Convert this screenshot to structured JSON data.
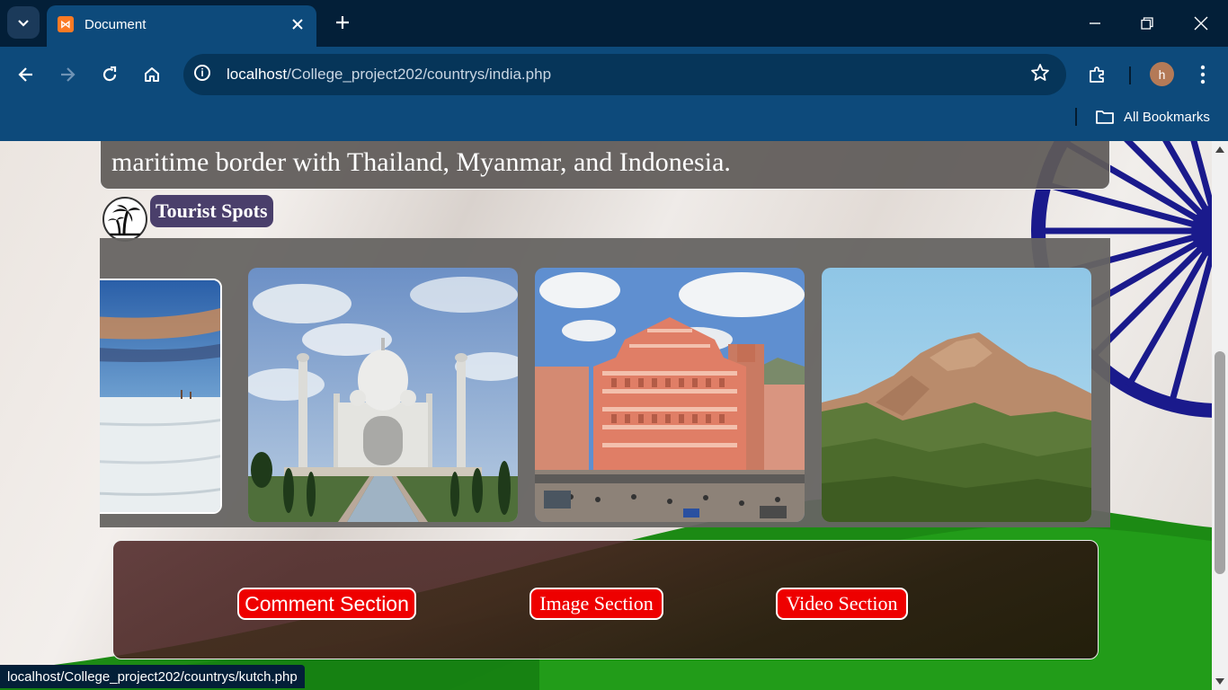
{
  "browser": {
    "tab_title": "Document",
    "favicon_glyph": "⋈",
    "url_host": "localhost",
    "url_path": "/College_project202/countrys/india.php",
    "profile_initial": "h",
    "bookmarks_label": "All Bookmarks",
    "status_url": "localhost/College_project202/countrys/kutch.php"
  },
  "page": {
    "description_line": "maritime border with Thailand, Myanmar, and Indonesia.",
    "tourist_spots_label": "Tourist Spots",
    "gallery": [
      {
        "name": "white-desert-photo"
      },
      {
        "name": "taj-mahal-photo"
      },
      {
        "name": "hawa-mahal-photo"
      },
      {
        "name": "mountain-photo"
      }
    ],
    "buttons": {
      "comment": "Comment Section",
      "image": "Image Section",
      "video": "Video Section"
    }
  },
  "colors": {
    "chrome_dark": "#031f38",
    "chrome_toolbar": "#0d4a7b",
    "button_red": "#ee0000",
    "label_purple": "#4a3f6b"
  }
}
